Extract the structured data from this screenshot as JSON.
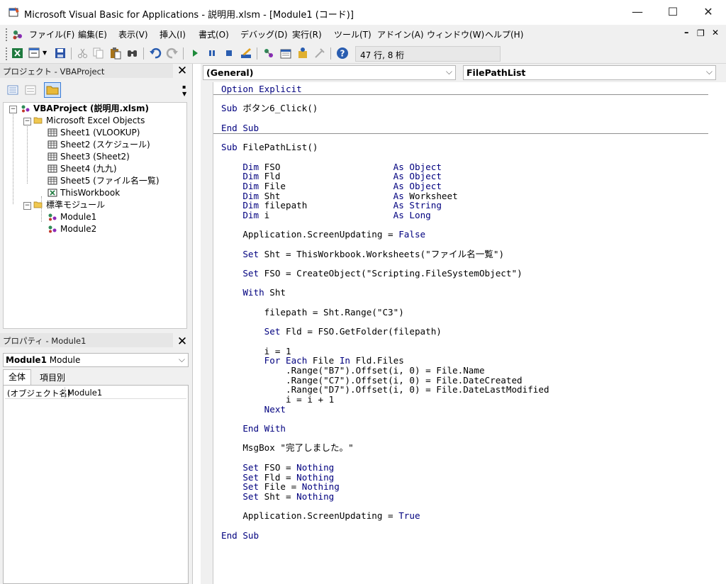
{
  "window": {
    "title": "Microsoft Visual Basic for Applications - 説明用.xlsm - [Module1 (コード)]",
    "minimize": "—",
    "maximize": "☐",
    "close": "✕"
  },
  "menubar": {
    "items": [
      "ファイル(F)",
      "編集(E)",
      "表示(V)",
      "挿入(I)",
      "書式(O)",
      "デバッグ(D)",
      "実行(R)",
      "ツール(T)",
      "アドイン(A)",
      "ウィンドウ(W)",
      "ヘルプ(H)"
    ],
    "mdi_minimize": "–",
    "mdi_restore": "❐",
    "mdi_close": "✕"
  },
  "toolbar": {
    "position": "47 行, 8 桁"
  },
  "project": {
    "title": "プロジェクト - VBAProject",
    "root": "VBAProject (説明用.xlsm)",
    "folder_excel": "Microsoft Excel Objects",
    "sheets": [
      "Sheet1 (VLOOKUP)",
      "Sheet2 (スケジュール)",
      "Sheet3 (Sheet2)",
      "Sheet4 (九九)",
      "Sheet5 (ファイル名一覧)",
      "ThisWorkbook"
    ],
    "folder_modules": "標準モジュール",
    "modules": [
      "Module1",
      "Module2"
    ]
  },
  "properties": {
    "title": "プロパティ - Module1",
    "object_name": "Module1",
    "object_type": "Module",
    "tabs": [
      "全体",
      "項目別"
    ],
    "row_name": "(オブジェクト名)",
    "row_value": "Module1"
  },
  "code": {
    "object_combo": "(General)",
    "procedure_combo": "FilePathList",
    "lines": [
      "Option Explicit",
      "",
      "Sub ボタン6_Click()",
      "",
      "End Sub",
      "",
      "Sub FilePathList()",
      "",
      "    Dim FSO                     As Object",
      "    Dim Fld                     As Object",
      "    Dim File                    As Object",
      "    Dim Sht                     As Worksheet",
      "    Dim filepath                As String",
      "    Dim i                       As Long",
      "",
      "    Application.ScreenUpdating = False",
      "",
      "    Set Sht = ThisWorkbook.Worksheets(\"ファイル名一覧\")",
      "",
      "    Set FSO = CreateObject(\"Scripting.FileSystemObject\")",
      "",
      "    With Sht",
      "",
      "        filepath = Sht.Range(\"C3\")",
      "",
      "        Set Fld = FSO.GetFolder(filepath)",
      "",
      "        i = 1",
      "        For Each File In Fld.Files",
      "            .Range(\"B7\").Offset(i, 0) = File.Name",
      "            .Range(\"C7\").Offset(i, 0) = File.DateCreated",
      "            .Range(\"D7\").Offset(i, 0) = File.DateLastModified",
      "            i = i + 1",
      "        Next",
      "",
      "    End With",
      "",
      "    MsgBox \"完了しました。\"",
      "",
      "    Set FSO = Nothing",
      "    Set Fld = Nothing",
      "    Set File = Nothing",
      "    Set Sht = Nothing",
      "",
      "    Application.ScreenUpdating = True",
      "",
      "End Sub"
    ]
  }
}
